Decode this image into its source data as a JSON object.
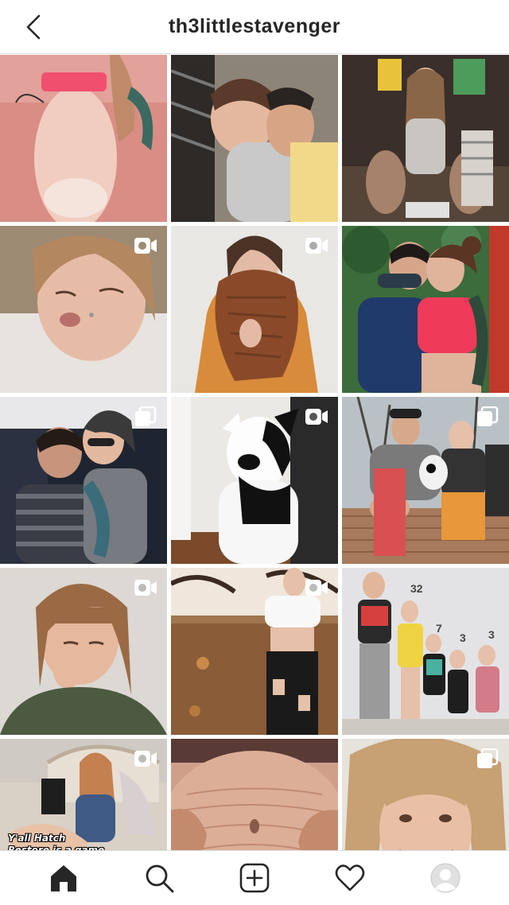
{
  "header": {
    "title": "th3littlestavenger",
    "back_icon": "chevron-left-icon"
  },
  "grid": {
    "posts": [
      {
        "type": "photo",
        "subject": "woman-torso-pink-top",
        "badge": ""
      },
      {
        "type": "photo",
        "subject": "couple-laughing",
        "badge": ""
      },
      {
        "type": "photo",
        "subject": "family-on-couch",
        "badge": ""
      },
      {
        "type": "video",
        "subject": "woman-sleeping",
        "badge": "video-camera-icon"
      },
      {
        "type": "video",
        "subject": "woman-with-scarf",
        "badge": "video-camera-icon"
      },
      {
        "type": "photo",
        "subject": "couple-kissing-red-top",
        "badge": ""
      },
      {
        "type": "carousel",
        "subject": "couple-on-sofa",
        "badge": "carousel-icon"
      },
      {
        "type": "video",
        "subject": "puppy",
        "badge": "video-camera-icon"
      },
      {
        "type": "carousel",
        "subject": "family-with-dog-on-deck",
        "badge": "carousel-icon"
      },
      {
        "type": "video",
        "subject": "woman-green-hoodie",
        "badge": "video-camera-icon"
      },
      {
        "type": "video",
        "subject": "woman-autumn-leaves",
        "badge": "video-camera-icon"
      },
      {
        "type": "photo",
        "subject": "family-lineup-ages",
        "badge": "",
        "numbers": [
          "32",
          "7",
          "3",
          "3"
        ]
      },
      {
        "type": "video",
        "subject": "woman-reading-in-bed",
        "badge": "video-camera-icon",
        "overlay_text": "Y'all Hatch Restore is a game changer!"
      },
      {
        "type": "photo",
        "subject": "belly-stretch-marks",
        "badge": ""
      },
      {
        "type": "carousel",
        "subject": "woman-smiling-selfie",
        "badge": "carousel-icon"
      }
    ]
  },
  "bottom_nav": {
    "items": [
      {
        "name": "home",
        "icon": "home-icon",
        "active": true
      },
      {
        "name": "search",
        "icon": "search-icon",
        "active": false
      },
      {
        "name": "new-post",
        "icon": "plus-square-icon",
        "active": false
      },
      {
        "name": "activity",
        "icon": "heart-icon",
        "active": false
      },
      {
        "name": "profile",
        "icon": "avatar-icon",
        "active": false
      }
    ]
  },
  "colors": {
    "border": "#dbdbdb",
    "text": "#262626",
    "icon": "#262626"
  }
}
